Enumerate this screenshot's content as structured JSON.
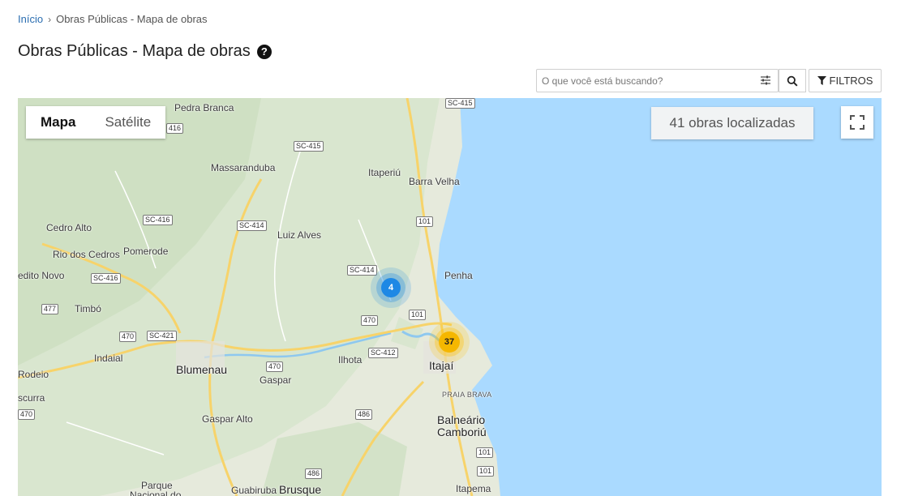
{
  "breadcrumb": {
    "home": "Início",
    "separator": "›",
    "current": "Obras Públicas - Mapa de obras"
  },
  "page": {
    "title": "Obras Públicas - Mapa de obras",
    "help_icon": "?"
  },
  "search": {
    "placeholder": "O que você está buscando?",
    "value": "",
    "filters_label": "FILTROS"
  },
  "map": {
    "type_buttons": {
      "map": "Mapa",
      "satellite": "Satélite"
    },
    "count_label": "41 obras localizadas",
    "clusters": {
      "blue": "4",
      "yellow": "37"
    },
    "places": {
      "pedra_branca": "Pedra Branca",
      "massaranduba": "Massaranduba",
      "itaperiu": "Itaperiú",
      "barra_velha": "Barra Velha",
      "cedro_alto": "Cedro Alto",
      "rio_dos_cedros": "Rio dos Cedros",
      "pomerode": "Pomerode",
      "luiz_alves": "Luiz Alves",
      "penha": "Penha",
      "edito_novo": "edito Novo",
      "timbo": "Timbó",
      "indaial": "Indaial",
      "blumenau": "Blumenau",
      "gaspar": "Gaspar",
      "ilhota": "Ilhota",
      "itajai": "Itajaí",
      "praia_brava": "PRAIA BRAVA",
      "rodeio": "Rodeio",
      "ascurra": "scurra",
      "gaspar_alto": "Gaspar Alto",
      "balneario": "Balneário",
      "camboriu": "Camboriú",
      "parque": "Parque",
      "nacional": "Nacional do",
      "guabiruba": "Guabiruba",
      "brusque": "Brusque",
      "itapema": "Itapema"
    },
    "road_shields": {
      "sc415_a": "SC-415",
      "r416_a": "416",
      "sc415_b": "SC-415",
      "sc416_a": "SC-416",
      "sc414_a": "SC-414",
      "r101_a": "101",
      "sc414_b": "SC-414",
      "sc416_b": "SC-416",
      "r477": "477",
      "r101_b": "101",
      "r470_a": "470",
      "sc421": "SC-421",
      "r470_b": "470",
      "sc412": "SC-412",
      "r470_c": "470",
      "r470_d": "470",
      "r486_a": "486",
      "r101_c": "101",
      "r101_d": "101",
      "r486_b": "486"
    }
  }
}
